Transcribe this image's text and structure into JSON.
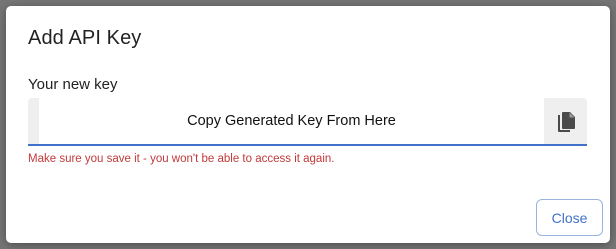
{
  "dialog": {
    "title": "Add API Key",
    "field_label": "Your new key",
    "key_value": "Copy Generated Key From Here",
    "warning": "Make sure you save it - you won't be able to access it again.",
    "close_label": "Close",
    "copy_icon": "copy-icon"
  },
  "colors": {
    "accent": "#3f72c8",
    "warning": "#c23a3a",
    "backdrop": "#767676"
  }
}
